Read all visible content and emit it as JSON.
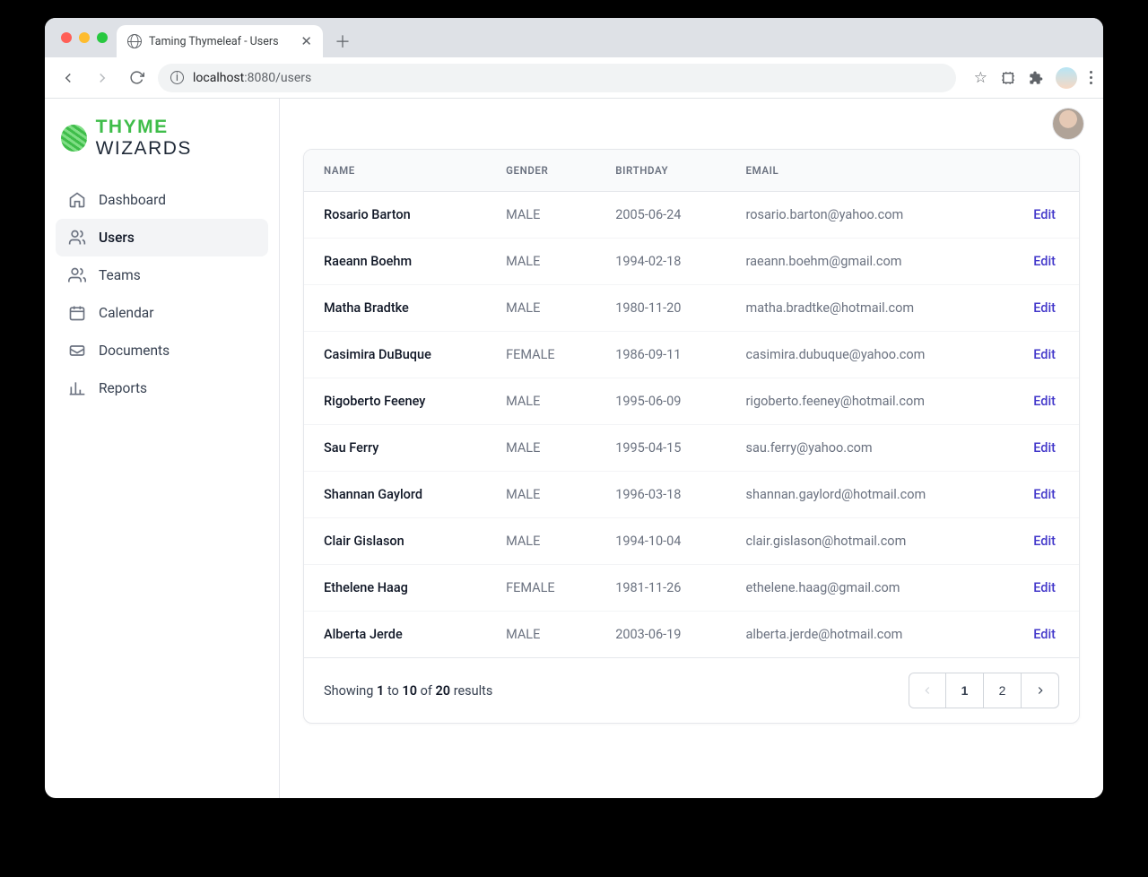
{
  "browser": {
    "tab_title": "Taming Thymeleaf - Users",
    "url_host": "localhost",
    "url_port": ":8080",
    "url_path": "/users"
  },
  "logo": {
    "thyme": "THYME",
    "wizards": " WIZARDS"
  },
  "sidebar": {
    "items": [
      {
        "label": "Dashboard",
        "icon": "home-icon"
      },
      {
        "label": "Users",
        "icon": "users-icon"
      },
      {
        "label": "Teams",
        "icon": "teams-icon"
      },
      {
        "label": "Calendar",
        "icon": "calendar-icon"
      },
      {
        "label": "Documents",
        "icon": "documents-icon"
      },
      {
        "label": "Reports",
        "icon": "reports-icon"
      }
    ],
    "active_index": 1
  },
  "table": {
    "headers": {
      "name": "NAME",
      "gender": "GENDER",
      "birthday": "BIRTHDAY",
      "email": "EMAIL"
    },
    "edit_label": "Edit",
    "rows": [
      {
        "name": "Rosario Barton",
        "gender": "MALE",
        "birthday": "2005-06-24",
        "email": "rosario.barton@yahoo.com"
      },
      {
        "name": "Raeann Boehm",
        "gender": "MALE",
        "birthday": "1994-02-18",
        "email": "raeann.boehm@gmail.com"
      },
      {
        "name": "Matha Bradtke",
        "gender": "MALE",
        "birthday": "1980-11-20",
        "email": "matha.bradtke@hotmail.com"
      },
      {
        "name": "Casimira DuBuque",
        "gender": "FEMALE",
        "birthday": "1986-09-11",
        "email": "casimira.dubuque@yahoo.com"
      },
      {
        "name": "Rigoberto Feeney",
        "gender": "MALE",
        "birthday": "1995-06-09",
        "email": "rigoberto.feeney@hotmail.com"
      },
      {
        "name": "Sau Ferry",
        "gender": "MALE",
        "birthday": "1995-04-15",
        "email": "sau.ferry@yahoo.com"
      },
      {
        "name": "Shannan Gaylord",
        "gender": "MALE",
        "birthday": "1996-03-18",
        "email": "shannan.gaylord@hotmail.com"
      },
      {
        "name": "Clair Gislason",
        "gender": "MALE",
        "birthday": "1994-10-04",
        "email": "clair.gislason@hotmail.com"
      },
      {
        "name": "Ethelene Haag",
        "gender": "FEMALE",
        "birthday": "1981-11-26",
        "email": "ethelene.haag@gmail.com"
      },
      {
        "name": "Alberta Jerde",
        "gender": "MALE",
        "birthday": "2003-06-19",
        "email": "alberta.jerde@hotmail.com"
      }
    ]
  },
  "pagination": {
    "showing_prefix": "Showing ",
    "from": "1",
    "to_word": " to ",
    "to": "10",
    "of_word": " of ",
    "total": "20",
    "results_word": " results",
    "pages": [
      "1",
      "2"
    ],
    "current_page": "1"
  }
}
